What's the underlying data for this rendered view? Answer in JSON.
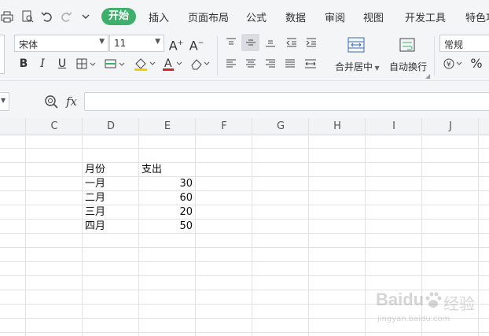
{
  "menu": {
    "tabs": [
      "开始",
      "插入",
      "页面布局",
      "公式",
      "数据",
      "审阅",
      "视图",
      "开发工具",
      "特色功"
    ]
  },
  "ribbon": {
    "font_name": "宋体",
    "font_size": "11",
    "merge_label": "合并居中",
    "wrap_label": "自动换行",
    "number_format": "常规",
    "percent": "%"
  },
  "formula": {
    "fx": "fx",
    "value": ""
  },
  "columns": [
    "C",
    "D",
    "E",
    "F",
    "G",
    "H",
    "I",
    "J"
  ],
  "table": {
    "header": [
      "月份",
      "支出"
    ],
    "rows": [
      {
        "month": "一月",
        "value": "30"
      },
      {
        "month": "二月",
        "value": "60"
      },
      {
        "month": "三月",
        "value": "20"
      },
      {
        "month": "四月",
        "value": "50"
      }
    ]
  },
  "watermark": {
    "brand": "Baidu",
    "sub": "经验",
    "url": "jingyan.baidu.com"
  },
  "colors": {
    "accent": "#3fb06c",
    "grid": "#e1e2e4",
    "chrome": "#f4f5f7"
  }
}
